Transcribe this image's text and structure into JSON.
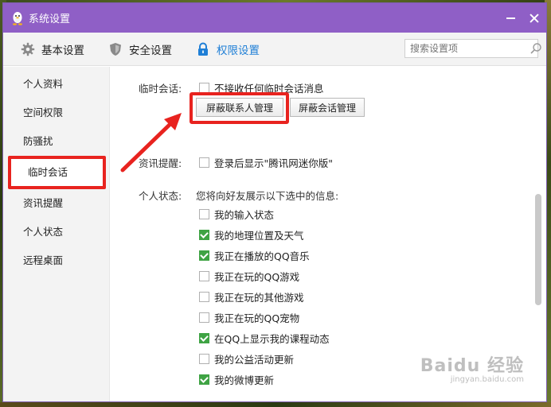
{
  "window": {
    "title": "系统设置"
  },
  "tabs": [
    {
      "label": "基本设置",
      "icon": "gear-icon"
    },
    {
      "label": "安全设置",
      "icon": "shield-icon"
    },
    {
      "label": "权限设置",
      "icon": "lock-icon",
      "active": true
    }
  ],
  "search": {
    "placeholder": "搜索设置项"
  },
  "sidebar": {
    "items": [
      {
        "label": "个人资料"
      },
      {
        "label": "空间权限"
      },
      {
        "label": "防骚扰"
      },
      {
        "label": "临时会话",
        "active": true
      },
      {
        "label": "资讯提醒"
      },
      {
        "label": "个人状态"
      },
      {
        "label": "远程桌面"
      }
    ]
  },
  "temp_session": {
    "label": "临时会话:",
    "option": "不接收任何临时会话消息",
    "checked": false,
    "block_contacts_button": "屏蔽联系人管理",
    "block_sessions_button": "屏蔽会话管理"
  },
  "news_alert": {
    "label": "资讯提醒:",
    "option": "登录后显示\"腾讯网迷你版\"",
    "checked": false
  },
  "personal_status": {
    "label": "个人状态:",
    "description": "您将向好友展示以下选中的信息:",
    "options": [
      {
        "label": "我的输入状态",
        "checked": false
      },
      {
        "label": "我的地理位置及天气",
        "checked": true
      },
      {
        "label": "我正在播放的QQ音乐",
        "checked": true
      },
      {
        "label": "我正在玩的QQ游戏",
        "checked": false
      },
      {
        "label": "我正在玩的其他游戏",
        "checked": false
      },
      {
        "label": "我正在玩的QQ宠物",
        "checked": false
      },
      {
        "label": "在QQ上显示我的课程动态",
        "checked": true
      },
      {
        "label": "我的公益活动更新",
        "checked": false
      },
      {
        "label": "我的微博更新",
        "checked": true
      }
    ]
  },
  "watermark": {
    "main": "Baidu 经验",
    "sub": "jingyan.baidu.com"
  },
  "colors": {
    "titlebar": "#8f5fc6",
    "accent_blue": "#1f7fd6",
    "highlight_red": "#e8231f",
    "check_green": "#3fa344"
  }
}
